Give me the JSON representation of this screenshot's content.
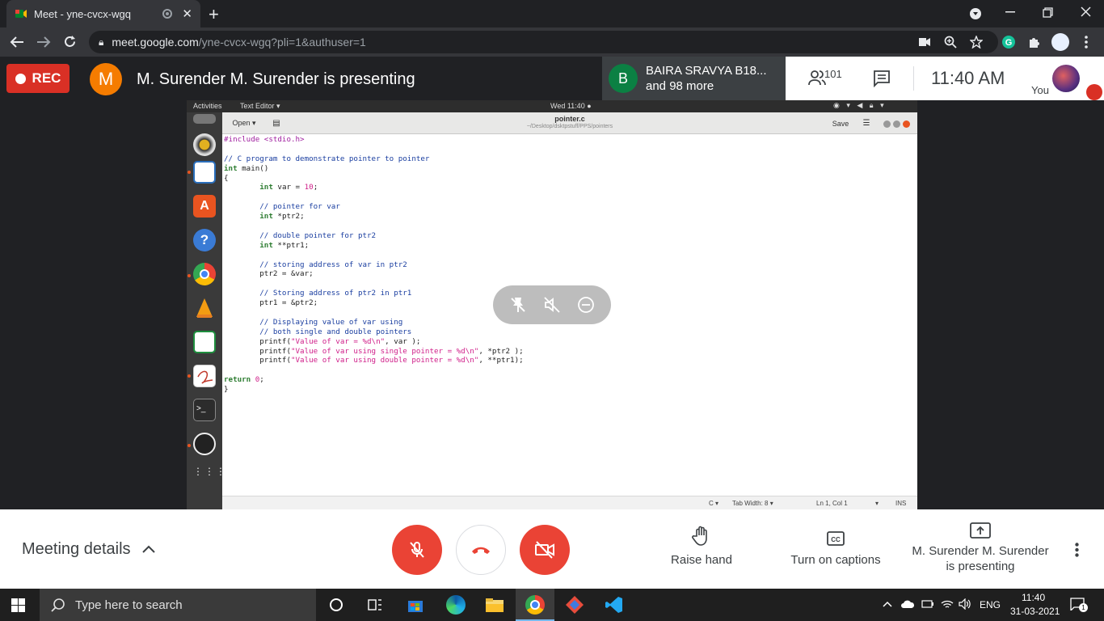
{
  "browser": {
    "tab_title": "Meet - yne-cvcx-wgq",
    "new_tab": "+",
    "close_tab": "✕",
    "url_host": "meet.google.com",
    "url_path": "/yne-cvcx-wgq?pli=1&authuser=1"
  },
  "meet": {
    "rec_label": "REC",
    "presenter_initial": "M",
    "presenter_text": "M. Surender M. Surender is presenting",
    "participant_initial": "B",
    "participant_name": "BAIRA SRAVYA B18...",
    "participant_more": "and 98 more",
    "people_count": "101",
    "time": "11:40  AM",
    "you_label": "You"
  },
  "screen": {
    "activities": "Activities",
    "app_menu": "Text Editor ▾",
    "clock": "Wed 11:40 ●",
    "open_label": "Open ▾",
    "file_name": "pointer.c",
    "file_path": "~/Desktop/dsktpstuff/PPS/pointers",
    "save_label": "Save",
    "code_lines": [
      "#include <stdio.h>",
      "",
      "// C program to demonstrate pointer to pointer",
      "int main()",
      "{",
      "        int var = 10;",
      "",
      "        // pointer for var",
      "        int *ptr2;",
      "",
      "        // double pointer for ptr2",
      "        int **ptr1;",
      "",
      "        // storing address of var in ptr2",
      "        ptr2 = &var;",
      "",
      "        // Storing address of ptr2 in ptr1",
      "        ptr1 = &ptr2;",
      "",
      "        // Displaying value of var using",
      "        // both single and double pointers",
      "        printf(\"Value of var = %d\\n\", var );",
      "        printf(\"Value of var using single pointer = %d\\n\", *ptr2 );",
      "        printf(\"Value of var using double pointer = %d\\n\", **ptr1);",
      "",
      "return 0;",
      "}"
    ],
    "status_lang": "C ▾",
    "status_tab": "Tab Width: 8 ▾",
    "status_pos": "Ln 1, Col 1",
    "status_ins": "INS"
  },
  "controls": {
    "meeting_details": "Meeting details",
    "raise_hand": "Raise hand",
    "captions": "Turn on captions",
    "presenting_line1": "M. Surender M. Surender",
    "presenting_line2": "is presenting"
  },
  "taskbar": {
    "search_placeholder": "Type here to search",
    "lang": "ENG",
    "time": "11:40",
    "date": "31-03-2021",
    "notif_count": "1"
  },
  "colors": {
    "rec_red": "#d93025",
    "presenter_orange": "#f57c00",
    "participant_green": "#0b8043"
  }
}
